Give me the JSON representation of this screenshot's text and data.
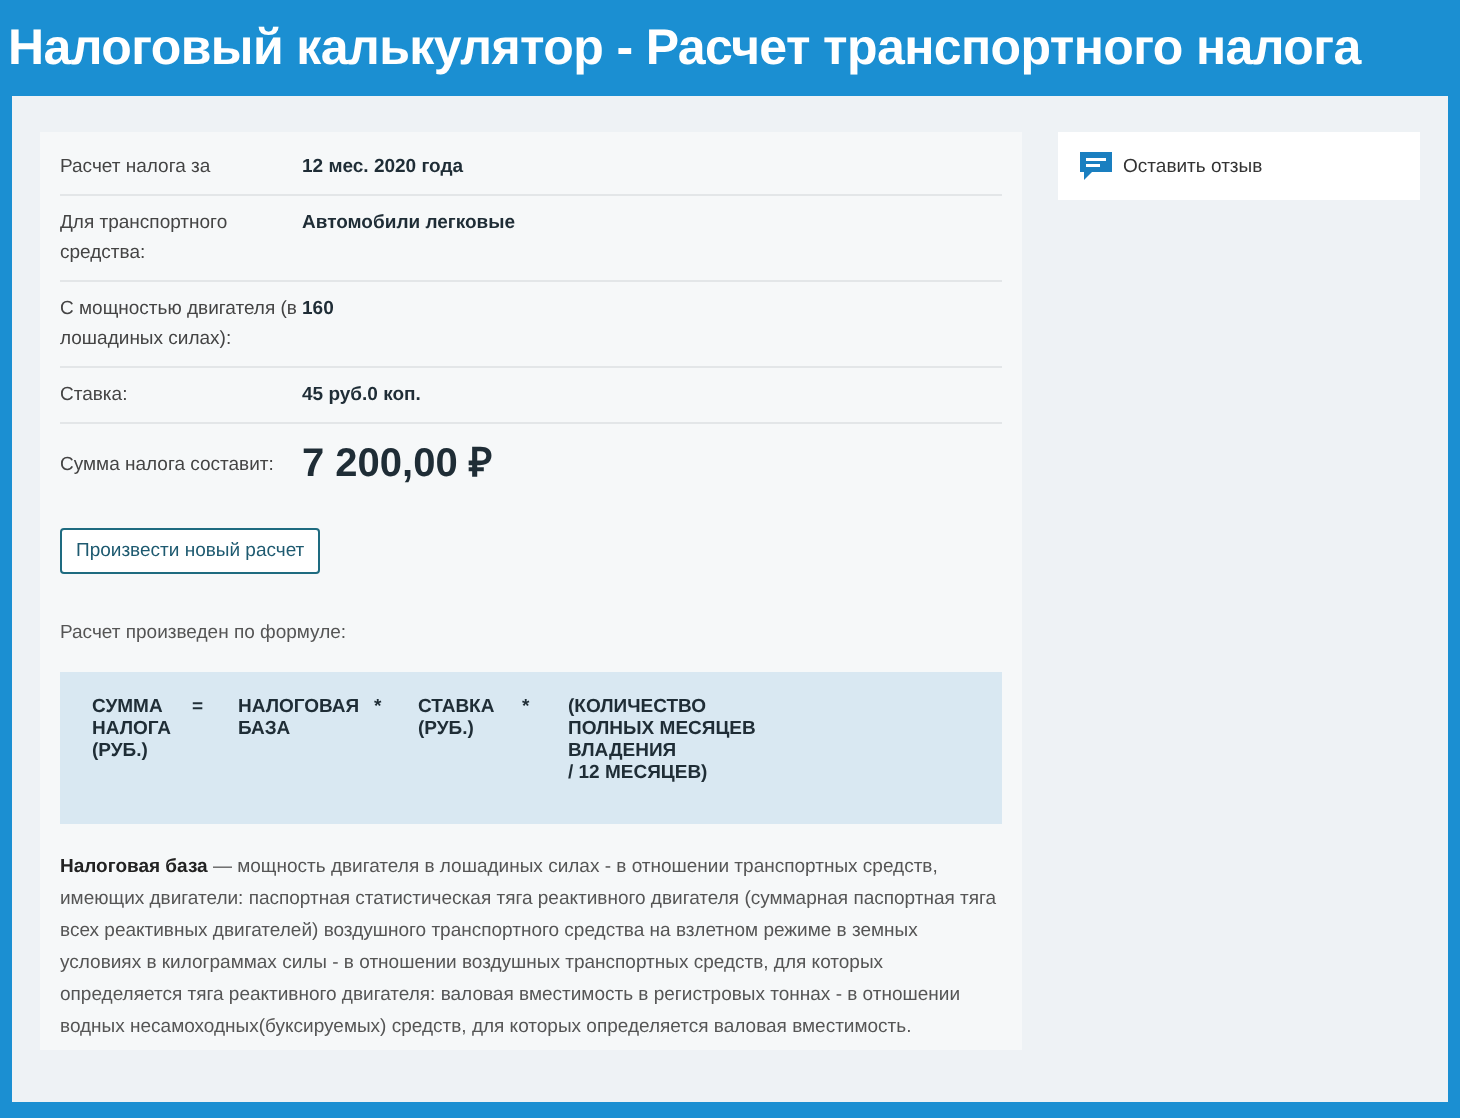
{
  "title": "Налоговый калькулятор - Расчет транспортного налога",
  "details": [
    {
      "label": "Расчет налога за",
      "value": "12 мес. 2020 года",
      "kind": "plain"
    },
    {
      "label": "Для транспортного средства:",
      "value": "Автомобили легковые",
      "kind": "plain"
    },
    {
      "label": "С мощностью двигателя (в лошадиных силах):",
      "value": "160",
      "kind": "plain"
    },
    {
      "label": "Ставка:",
      "value": "45 руб.0 коп.",
      "kind": "plain"
    },
    {
      "label": "Сумма налога составит:",
      "value": "7 200,00 ₽",
      "kind": "total"
    }
  ],
  "recalc_button": "Произвести новый расчет",
  "formula_caption": "Расчет произведен по формуле:",
  "formula": [
    "СУММА\nНАЛОГА\n(РУБ.)",
    "=",
    "НАЛОГОВАЯ\nБАЗА",
    "*",
    "СТАВКА\n(РУБ.)",
    "*",
    "(КОЛИЧЕСТВО\nПОЛНЫХ МЕСЯЦЕВ\nВЛАДЕНИЯ\n/ 12 МЕСЯЦЕВ)"
  ],
  "description": "**Налоговая база** — мощность двигателя в лошадиных силах - в отношении транспортных средств, имеющих двигатели: паспортная статистическая тяга реактивного двигателя (суммарная паспортная тяга всех реактивных двигателей) воздушного транспортного средства на взлетном режиме в земных условиях в килограммах силы - в отношении воздушных транспортных средств, для которых определяется тяга реактивного двигателя: валовая вместимость в регистровых тоннах - в отношении водных несамоходных(буксируемых) средств, для которых определяется валовая вместимость.",
  "feedback_link": "Оставить отзыв"
}
